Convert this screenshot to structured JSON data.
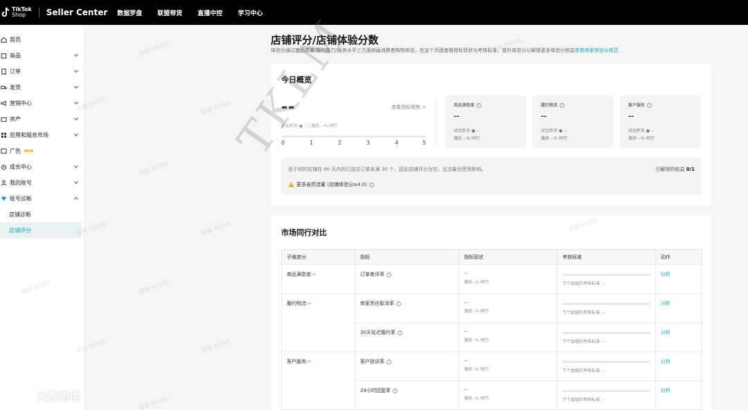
{
  "topbar": {
    "logo_line1": "TikTok",
    "logo_line2": "Shop",
    "brand": "Seller Center",
    "nav": [
      "数据罗盘",
      "联盟带货",
      "直播中控",
      "学习中心"
    ]
  },
  "sidebar": {
    "items": [
      {
        "label": "首页",
        "icon": "home-icon",
        "chevron": false
      },
      {
        "label": "商品",
        "icon": "product-icon",
        "chevron": true
      },
      {
        "label": "订单",
        "icon": "order-icon",
        "chevron": true
      },
      {
        "label": "发货",
        "icon": "truck-icon",
        "chevron": true
      },
      {
        "label": "营销中心",
        "icon": "marketing-icon",
        "chevron": true
      },
      {
        "label": "资产",
        "icon": "wallet-icon",
        "chevron": true
      },
      {
        "label": "应用和服务市场",
        "icon": "apps-icon",
        "chevron": true
      },
      {
        "label": "广告",
        "icon": "ad-icon",
        "chevron": false,
        "tag": "NEW"
      },
      {
        "label": "成长中心",
        "icon": "growth-icon",
        "chevron": true
      },
      {
        "label": "我的账号",
        "icon": "user-icon",
        "chevron": true
      },
      {
        "label": "账号诊断",
        "icon": "diagnosis-icon",
        "chevron": "up"
      }
    ],
    "sub_items": [
      "店铺诊断",
      "店铺评分"
    ]
  },
  "page": {
    "title": "店铺评分/店铺体验分数",
    "desc": "体验分通过商品质量/履约能力/服务水平三方面刻画消费者购物体验，在这个页面查看指标现状与考核标准，提升体验分以解锁更多体验分权益",
    "desc_link": "查看商家体验分规范"
  },
  "overview": {
    "title": "今日概览",
    "score": "--",
    "trend_link": "查看指标趋势 >",
    "compare": "对比昨天 ● -- | 落后 --% 同行",
    "scale": [
      "0",
      "1",
      "2",
      "3",
      "4",
      "5"
    ],
    "metrics": [
      {
        "title": "商品满意度",
        "value": "--",
        "compare": "对比昨天 ● --",
        "peer": "落后 --% 同行"
      },
      {
        "title": "履约物流",
        "value": "--",
        "compare": "对比昨天 ● --",
        "peer": "落后 --% 同行"
      },
      {
        "title": "客户服务",
        "value": "--",
        "compare": "对比昨天 ● --",
        "peer": "落后 --% 同行"
      }
    ],
    "notice": "由于你的店铺在 90 天内的已送达订单未满 30 个，因此店铺评分为空，且流量也受到影响。",
    "unlocked_label": "已解锁的权益",
    "unlocked_value": "0/1",
    "warning": "更多自然流量 (店铺体验分≥4.0)"
  },
  "comparison": {
    "title": "市场同行对比",
    "headers": [
      "子维度分",
      "指标",
      "指标现状",
      "考核标准",
      "动作"
    ],
    "groups": [
      {
        "dimension": "商品满意度:--",
        "rows": [
          {
            "indicator": "订单差评率",
            "current": "--",
            "peer": "落后 -% 同行",
            "standard": "下个层级的考核标准: --",
            "action": "分析"
          }
        ]
      },
      {
        "dimension": "履约物流:--",
        "rows": [
          {
            "indicator": "商家责任取消率",
            "current": "--",
            "peer": "落后 -% 同行",
            "standard": "下个层级的考核标准: --",
            "action": "分析"
          },
          {
            "indicator": "30天延迟履约率",
            "current": "--",
            "peer": "落后 -% 同行",
            "standard": "下个层级的考核标准: --",
            "action": "分析"
          }
        ]
      },
      {
        "dimension": "客户服务:--",
        "rows": [
          {
            "indicator": "客户投诉率",
            "current": "--",
            "peer": "落后 -% 同行",
            "standard": "下个层级的考核标准: --",
            "action": "分析"
          },
          {
            "indicator": "24小时回复率",
            "current": "--",
            "peer": "落后 -% 同行",
            "standard": "下个层级的考核标准: --",
            "action": "分析"
          }
        ]
      }
    ]
  },
  "watermarks": {
    "big": "TKLM",
    "small": "助客 89365",
    "corner": "大数跨境"
  },
  "colors": {
    "accent": "#1aa3b0",
    "warning": "#e6a000",
    "topbar": "#000000"
  }
}
